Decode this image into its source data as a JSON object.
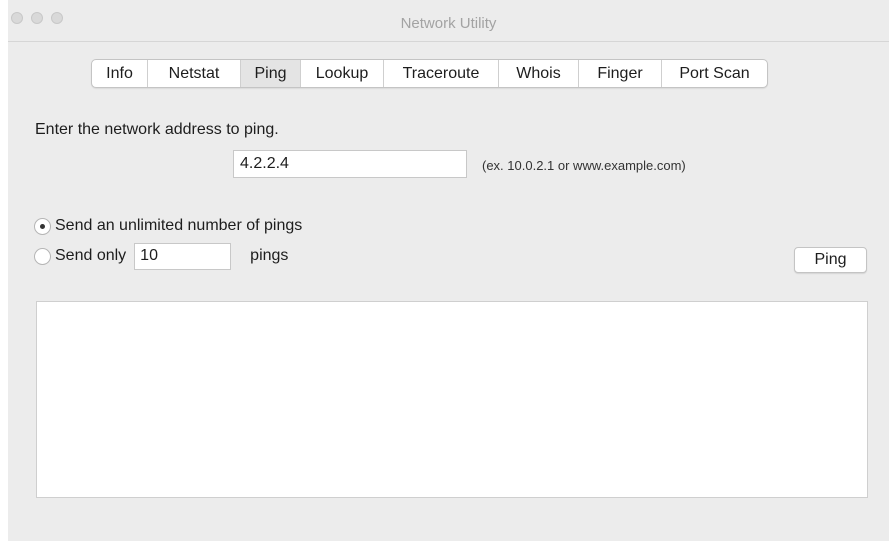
{
  "window": {
    "title": "Network Utility"
  },
  "tabs": [
    {
      "label": "Info",
      "selected": false
    },
    {
      "label": "Netstat",
      "selected": false
    },
    {
      "label": "Ping",
      "selected": true
    },
    {
      "label": "Lookup",
      "selected": false
    },
    {
      "label": "Traceroute",
      "selected": false
    },
    {
      "label": "Whois",
      "selected": false
    },
    {
      "label": "Finger",
      "selected": false
    },
    {
      "label": "Port Scan",
      "selected": false
    }
  ],
  "ping": {
    "prompt": "Enter the network address to ping.",
    "address_value": "4.2.2.4",
    "address_example": "(ex. 10.0.2.1 or www.example.com)",
    "unlimited_label": "Send an unlimited number of pings",
    "unlimited_selected": true,
    "only_label": "Send only",
    "only_count": "10",
    "pings_label": "pings",
    "button_label": "Ping",
    "output": ""
  }
}
